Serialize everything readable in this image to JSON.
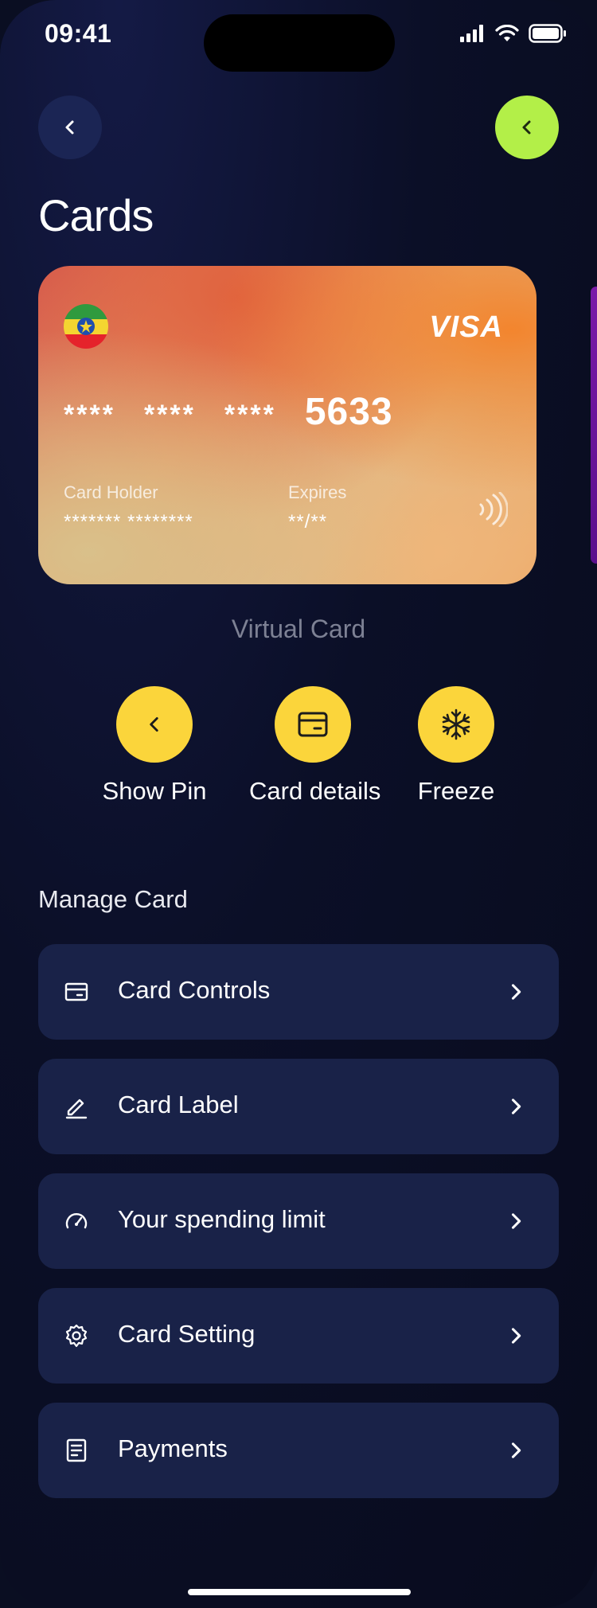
{
  "status_bar": {
    "time": "09:41"
  },
  "header": {
    "title": "Cards"
  },
  "card": {
    "brand": "VISA",
    "masked_groups": [
      "****",
      "****",
      "****"
    ],
    "last4": "5633",
    "holder_label": "Card Holder",
    "holder_value": "******* ********",
    "expires_label": "Expires",
    "expires_value": "**/**",
    "type_label": "Virtual Card"
  },
  "quick_actions": [
    {
      "label": "Show Pin",
      "icon": "chevron-left-icon"
    },
    {
      "label": "Card details",
      "icon": "card-icon"
    },
    {
      "label": "Freeze",
      "icon": "snowflake-icon"
    }
  ],
  "manage": {
    "title": "Manage Card",
    "items": [
      {
        "label": "Card Controls",
        "icon": "card-icon"
      },
      {
        "label": "Card Label",
        "icon": "pencil-icon"
      },
      {
        "label": "Your spending limit",
        "icon": "gauge-icon"
      },
      {
        "label": "Card Setting",
        "icon": "gear-icon"
      },
      {
        "label": "Payments",
        "icon": "receipt-icon"
      }
    ]
  },
  "colors": {
    "background": "#0b0f27",
    "menu_item": "#192248",
    "accent_green": "#b3ef48",
    "accent_yellow": "#fbd53b",
    "muted_text": "#7d8194"
  }
}
